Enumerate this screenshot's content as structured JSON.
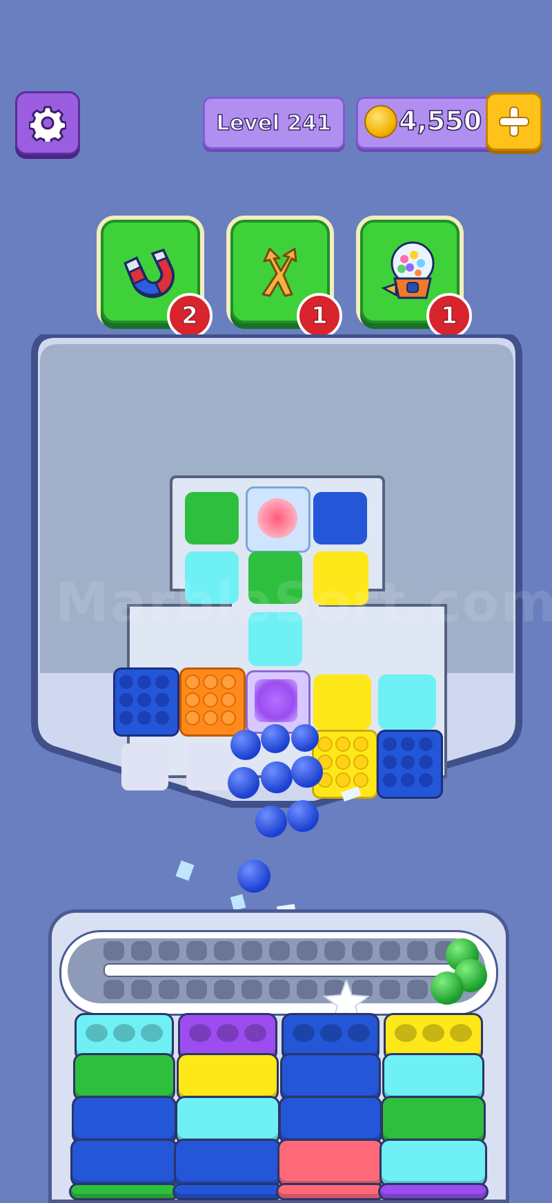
{
  "header": {
    "settings_icon": "gear-icon",
    "level_label": "Level 241",
    "coins": "4,550",
    "coin_icon": "coin-icon",
    "add_coins_icon": "plus-icon"
  },
  "boosters": [
    {
      "name": "magnet",
      "icon": "magnet-icon",
      "count": "2"
    },
    {
      "name": "split",
      "icon": "split-arrows-icon",
      "count": "1"
    },
    {
      "name": "gumball",
      "icon": "gumball-machine-icon",
      "count": "1"
    }
  ],
  "watermark": "MarbleSort.com",
  "colors": {
    "background": "#6a7fbf",
    "green": "#2fbf3f",
    "blue": "#2456d8",
    "cyan": "#6ff0f5",
    "yellow": "#ffe81a",
    "orange": "#ff8a1c",
    "red": "#ff6a7a",
    "purple": "#9c4df0",
    "booster_green": "#3fd13a",
    "badge_red": "#d8242c",
    "coin_gold": "#f4b400"
  }
}
